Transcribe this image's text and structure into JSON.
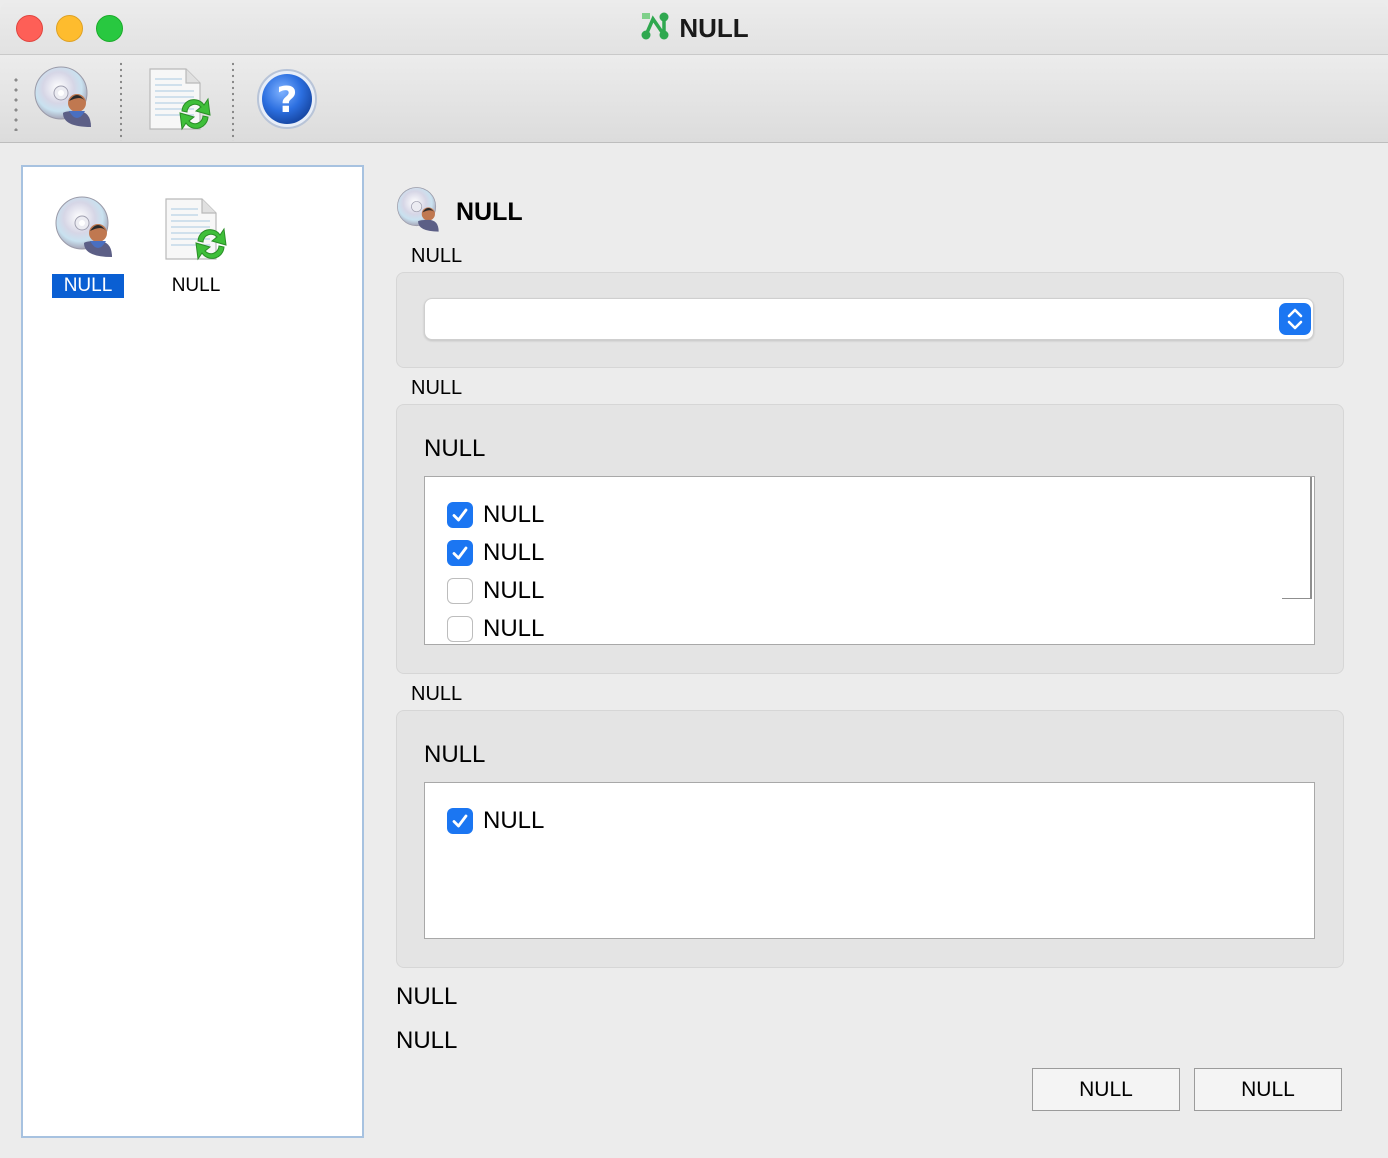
{
  "window": {
    "title": "NULL"
  },
  "toolbar": {
    "buttons": [
      {
        "icon": "cd-user-icon"
      },
      {
        "icon": "document-refresh-icon"
      },
      {
        "icon": "help-icon"
      }
    ]
  },
  "nav": {
    "items": [
      {
        "label": "NULL",
        "icon": "cd-user-icon",
        "selected": true
      },
      {
        "label": "NULL",
        "icon": "document-refresh-icon",
        "selected": false
      }
    ]
  },
  "content": {
    "section_title": "NULL",
    "group1": {
      "label": "NULL",
      "select_value": ""
    },
    "group2": {
      "label": "NULL",
      "inner_title": "NULL",
      "options": [
        {
          "label": "NULL",
          "checked": true
        },
        {
          "label": "NULL",
          "checked": true
        },
        {
          "label": "NULL",
          "checked": false
        },
        {
          "label": "NULL",
          "checked": false
        }
      ]
    },
    "group3": {
      "label": "NULL",
      "inner_title": "NULL",
      "options": [
        {
          "label": "NULL",
          "checked": true
        }
      ]
    },
    "status": [
      "NULL",
      "NULL"
    ]
  },
  "buttons": {
    "ok_label": "NULL",
    "cancel_label": "NULL"
  },
  "colors": {
    "accent": "#1b76f2",
    "selection": "#0a5fd3"
  }
}
